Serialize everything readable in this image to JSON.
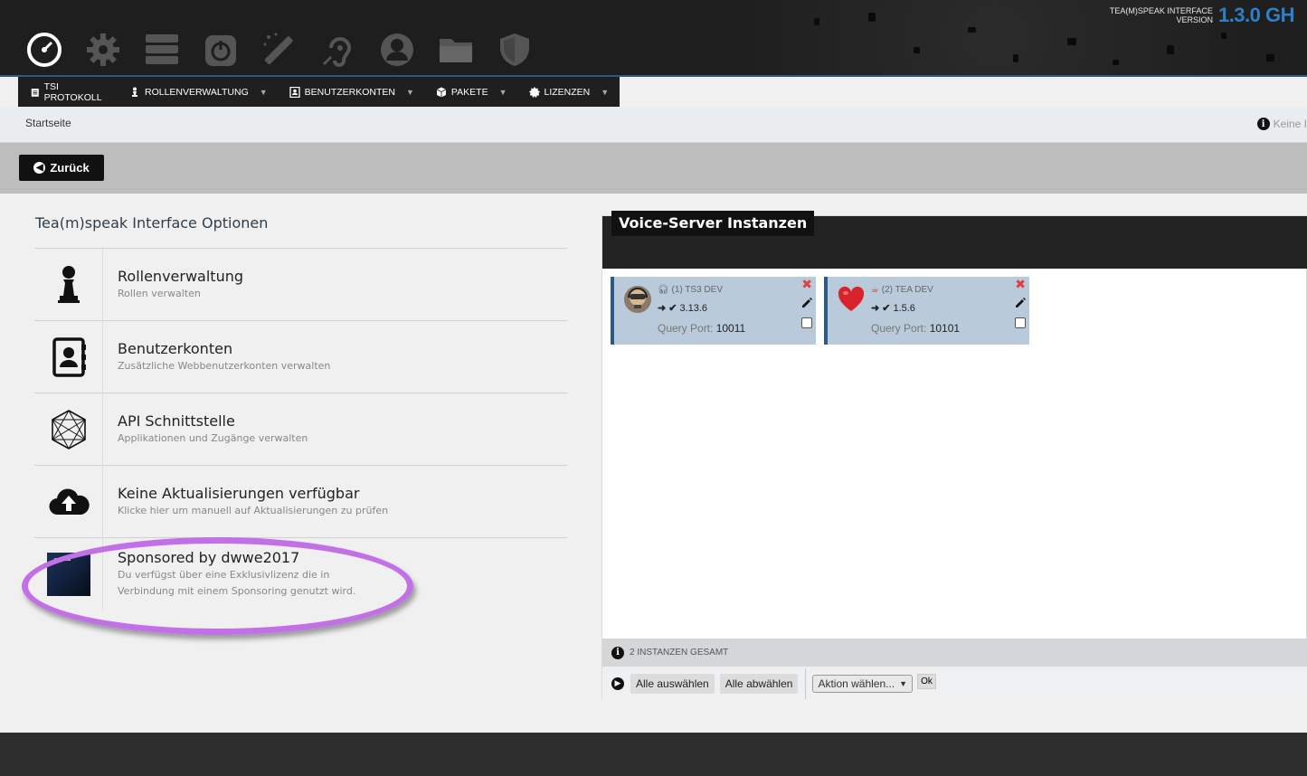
{
  "header": {
    "version_label_line1": "TEA(M)SPEAK INTERFACE",
    "version_label_line2": "VERSION",
    "version_number": "1.3.0 GH",
    "icons": [
      "dashboard-icon",
      "gear-icon",
      "server-icon",
      "power-icon",
      "magic-wand-icon",
      "hearing-icon",
      "user-icon",
      "folder-icon",
      "shield-icon"
    ]
  },
  "menu": {
    "items": [
      {
        "label": "TSI PROTOKOLL",
        "icon": "clipboard-icon",
        "dropdown": false
      },
      {
        "label": "ROLLENVERWALTUNG",
        "icon": "chess-pawn-icon",
        "dropdown": true
      },
      {
        "label": "BENUTZERKONTEN",
        "icon": "address-book-icon",
        "dropdown": true
      },
      {
        "label": "PAKETE",
        "icon": "cube-icon",
        "dropdown": true
      },
      {
        "label": "LIZENZEN",
        "icon": "certificate-icon",
        "dropdown": true
      }
    ],
    "caret": "▼"
  },
  "breadcrumb": {
    "home": "Startseite",
    "right_text": "Keine I"
  },
  "back_button": {
    "label": "Zurück"
  },
  "options": {
    "title": "Tea(m)speak Interface Optionen",
    "rows": [
      {
        "title": "Rollenverwaltung",
        "desc": "Rollen verwalten",
        "icon": "chess-pawn-icon"
      },
      {
        "title": "Benutzerkonten",
        "desc": "Zusätzliche Webbenutzerkonten verwalten",
        "icon": "address-book-icon"
      },
      {
        "title": "API Schnittstelle",
        "desc": "Applikationen und Zugänge verwalten",
        "icon": "api-network-icon"
      },
      {
        "title": "Keine Aktualisierungen verfügbar",
        "desc": "Klicke hier um manuell auf Aktualisierungen zu prüfen",
        "icon": "cloud-upload-icon"
      },
      {
        "title": "Sponsored by dwwe2017",
        "desc": "Du verfügst über eine Exklusivlizenz die in",
        "desc2": "Verbindung mit einem Sponsoring genutzt wird.",
        "icon": "sponsor-thumbnail"
      }
    ]
  },
  "instances": {
    "title": "Voice-Server Instanzen",
    "cards": [
      {
        "name": "(1) TS3 DEV",
        "version": "3.13.6",
        "query_label": "Query Port:",
        "query_port": "10011",
        "avatar": "ts3-avatar-icon"
      },
      {
        "name": "(2) TEA DEV",
        "version": "1.5.6",
        "query_label": "Query Port:",
        "query_port": "10101",
        "avatar": "heart-icon"
      }
    ],
    "total": "2 INSTANZEN GESAMT",
    "select_all": "Alle auswählen",
    "deselect_all": "Alle abwählen",
    "action_select": "Aktion wählen...",
    "ok": "Ok"
  },
  "colors": {
    "accent": "#2f7fc8",
    "card_bg": "#b9cadb",
    "highlight": "#c170e8"
  }
}
